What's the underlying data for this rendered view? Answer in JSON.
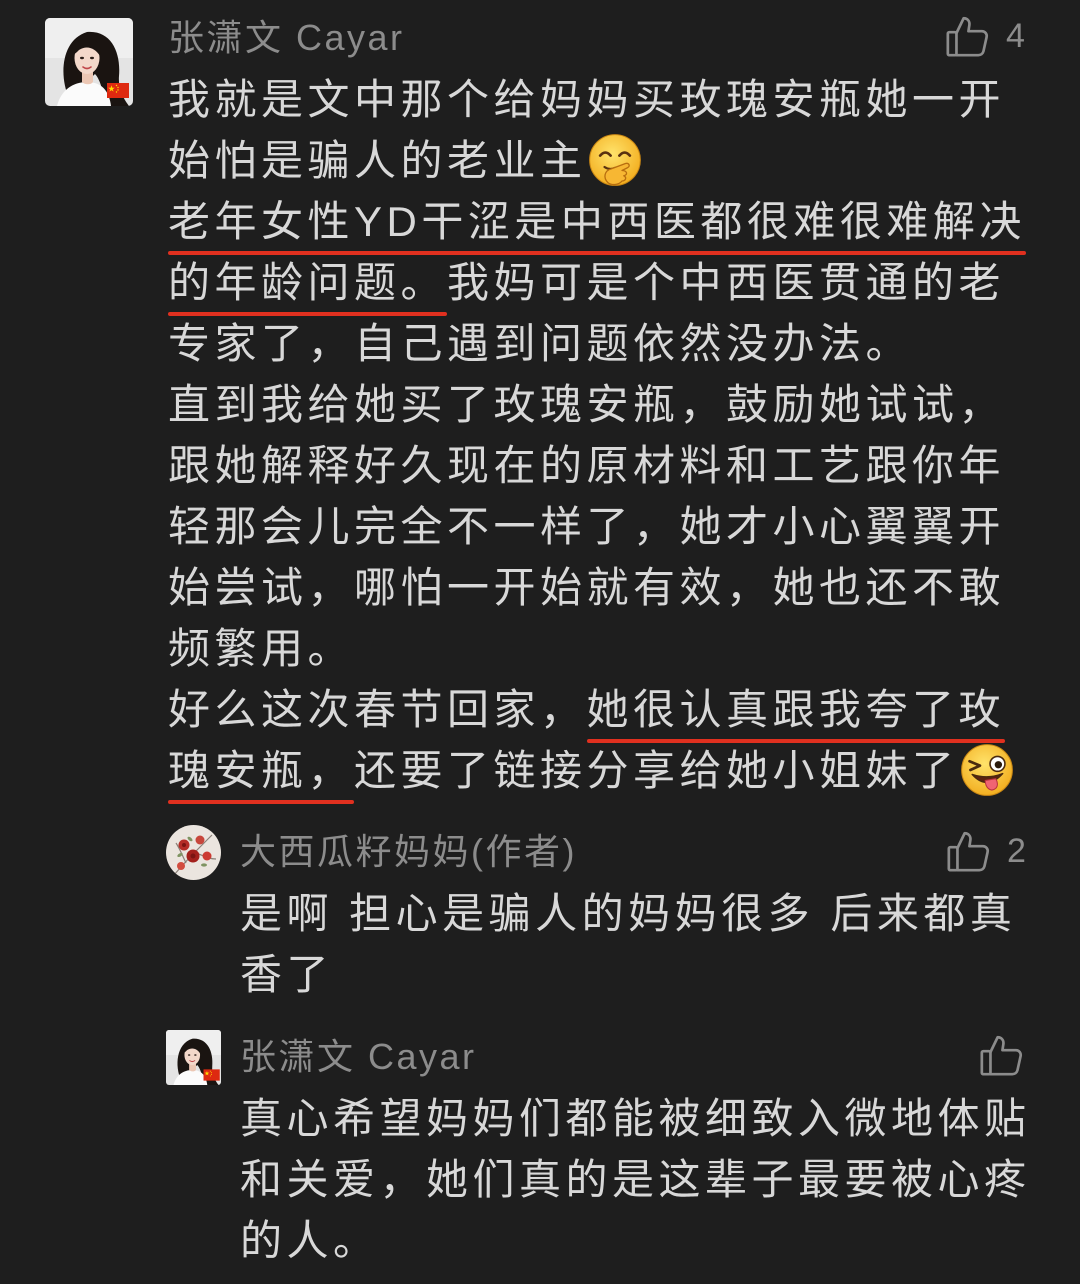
{
  "theme": {
    "background": "#1e1e1e",
    "text_color": "#d8d8d8",
    "meta_color": "#8c8c8c",
    "highlight_color": "#e0301f"
  },
  "main_comment": {
    "author": "张潇文 Cayar",
    "avatar_badge_icon": "china-flag-icon",
    "like_icon": "thumbs-up-icon",
    "like_count": "4",
    "lines": [
      {
        "segments": [
          {
            "text": "我就是文中那个给妈妈买玫瑰安瓶她一开"
          }
        ]
      },
      {
        "segments": [
          {
            "text": "始怕是骗人的老业主"
          }
        ],
        "emoji": "face-with-hand-over-mouth"
      },
      {
        "segments": [
          {
            "text": "老年女性YD干涩是中西医都很难很难解决",
            "highlighted": true
          }
        ]
      },
      {
        "segments": [
          {
            "text": "的年龄问题。",
            "highlighted": true
          },
          {
            "text": "我妈可是个中西医贯通的老"
          }
        ]
      },
      {
        "segments": [
          {
            "text": "专家了，自己遇到问题依然没办法。"
          }
        ]
      },
      {
        "segments": [
          {
            "text": "直到我给她买了玫瑰安瓶，鼓励她试试，"
          }
        ]
      },
      {
        "segments": [
          {
            "text": "跟她解释好久现在的原材料和工艺跟你年"
          }
        ]
      },
      {
        "segments": [
          {
            "text": "轻那会儿完全不一样了，她才小心翼翼开"
          }
        ]
      },
      {
        "segments": [
          {
            "text": "始尝试，哪怕一开始就有效，她也还不敢"
          }
        ]
      },
      {
        "segments": [
          {
            "text": "频繁用。"
          }
        ]
      },
      {
        "segments": [
          {
            "text": "好么这次春节回家，"
          },
          {
            "text": "她很认真跟我夸了玫",
            "highlighted": true
          }
        ]
      },
      {
        "segments": [
          {
            "text": "瑰安瓶，",
            "highlighted": true
          },
          {
            "text": "还要了链接分享给她小姐妹了"
          }
        ],
        "emoji": "winking-face-with-tongue"
      }
    ]
  },
  "replies": [
    {
      "author": "大西瓜籽妈妈(作者)",
      "like_icon": "thumbs-up-icon",
      "like_count": "2",
      "lines": [
        "是啊 担心是骗人的妈妈很多 后来都真",
        "香了"
      ]
    },
    {
      "author": "张潇文 Cayar",
      "avatar_badge_icon": "china-flag-icon",
      "like_icon": "thumbs-up-icon",
      "lines": [
        "真心希望妈妈们都能被细致入微地体贴",
        "和关爱，她们真的是这辈子最要被心疼",
        "的人。"
      ]
    }
  ]
}
